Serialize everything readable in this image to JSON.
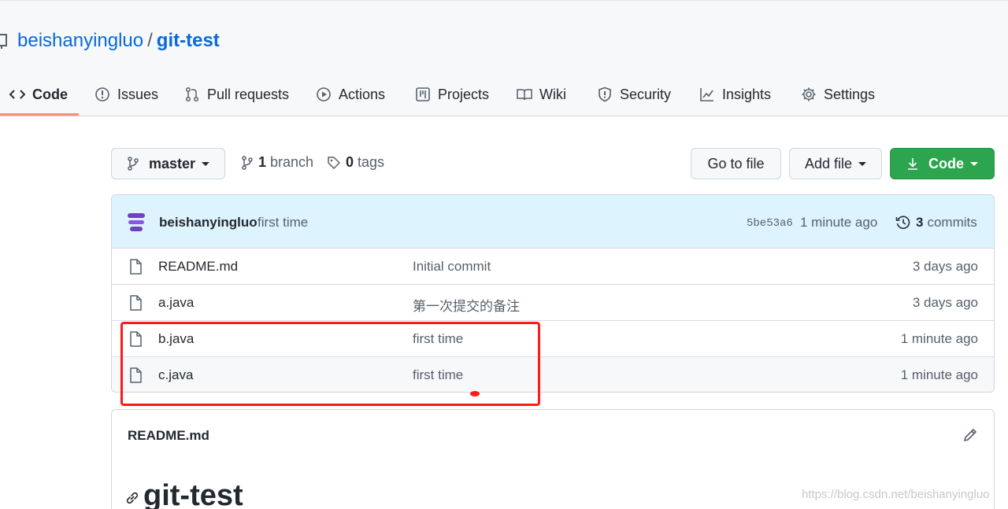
{
  "repo": {
    "owner": "beishanyingluo",
    "separator": "/",
    "name": "git-test"
  },
  "tabs": [
    {
      "label": "Code",
      "icon": "code-icon",
      "selected": true
    },
    {
      "label": "Issues",
      "icon": "issue-opened-icon"
    },
    {
      "label": "Pull requests",
      "icon": "git-pull-request-icon"
    },
    {
      "label": "Actions",
      "icon": "play-icon"
    },
    {
      "label": "Projects",
      "icon": "table-icon"
    },
    {
      "label": "Wiki",
      "icon": "book-icon"
    },
    {
      "label": "Security",
      "icon": "shield-icon"
    },
    {
      "label": "Insights",
      "icon": "graph-icon"
    },
    {
      "label": "Settings",
      "icon": "gear-icon"
    }
  ],
  "toolbar": {
    "branch": "master",
    "branch_count": "1",
    "branch_label": "branch",
    "tag_count": "0",
    "tag_label": "tags",
    "go_to_file": "Go to file",
    "add_file": "Add file",
    "code": "Code"
  },
  "commit": {
    "author": "beishanyingluo",
    "message": "first time",
    "sha": "5be53a6",
    "age": "1 minute ago",
    "commit_count": "3",
    "commit_label": "commits"
  },
  "files": [
    {
      "name": "README.md",
      "message": "Initial commit",
      "age": "3 days ago"
    },
    {
      "name": "a.java",
      "message": "第一次提交的备注",
      "age": "3 days ago"
    },
    {
      "name": "b.java",
      "message": "first time",
      "age": "1 minute ago"
    },
    {
      "name": "c.java",
      "message": "first time",
      "age": "1 minute ago"
    }
  ],
  "readme": {
    "filename": "README.md",
    "heading": "git-test"
  },
  "watermark": "https://blog.csdn.net/beishanyingluo",
  "colors": {
    "link": "#0969da",
    "primary_button": "#2da44e",
    "tab_underline": "#fd8c73",
    "commit_bar": "#ddf4ff",
    "annotation": "#ff1a1a",
    "avatar": "#6f42c1"
  }
}
